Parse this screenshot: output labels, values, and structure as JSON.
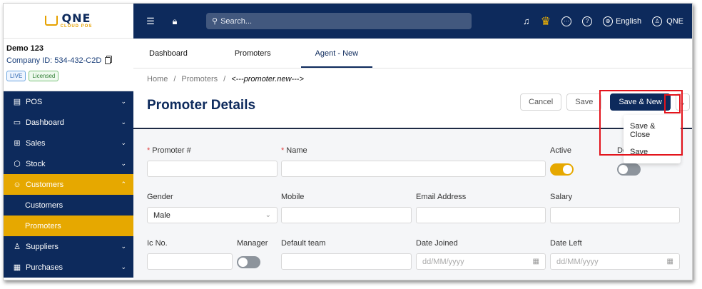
{
  "logo": {
    "main": "QNE",
    "sub": "CLOUD POS"
  },
  "company": {
    "name": "Demo 123",
    "id": "Company ID: 534-432-C2D",
    "badge_live": "LIVE",
    "badge_licensed": "Licensed"
  },
  "nav": {
    "pos": "POS",
    "dashboard": "Dashboard",
    "sales": "Sales",
    "stock": "Stock",
    "customers": "Customers",
    "sub_customers": "Customers",
    "sub_promoters": "Promoters",
    "suppliers": "Suppliers",
    "purchases": "Purchases"
  },
  "topbar": {
    "search_placeholder": "Search...",
    "language": "English",
    "user": "QNE"
  },
  "tabs": {
    "t1": "Dashboard",
    "t2": "Promoters",
    "t3": "Agent - New"
  },
  "breadcrumb": {
    "home": "Home",
    "sep": "/",
    "promoters": "Promoters",
    "current": "<---promoter.new--->"
  },
  "page_title": "Promoter Details",
  "actions": {
    "cancel": "Cancel",
    "save": "Save",
    "save_new": "Save & New"
  },
  "dropdown": {
    "save_close": "Save & Close",
    "save": "Save"
  },
  "form": {
    "promoter_no": {
      "label": "Promoter #",
      "value": ""
    },
    "name": {
      "label": "Name",
      "value": ""
    },
    "active": {
      "label": "Active",
      "on": true
    },
    "default_label": "De",
    "gender": {
      "label": "Gender",
      "value": "Male"
    },
    "mobile": {
      "label": "Mobile",
      "value": ""
    },
    "email": {
      "label": "Email Address",
      "value": ""
    },
    "salary": {
      "label": "Salary",
      "value": ""
    },
    "ic_no": {
      "label": "Ic No.",
      "value": ""
    },
    "manager": {
      "label": "Manager",
      "on": false
    },
    "default_team": {
      "label": "Default team",
      "value": ""
    },
    "date_joined": {
      "label": "Date Joined",
      "placeholder": "dd/MM/yyyy"
    },
    "date_left": {
      "label": "Date Left",
      "placeholder": "dd/MM/yyyy"
    }
  },
  "colors": {
    "navy": "#0d2a5c",
    "accent": "#e6a800",
    "highlight": "#e3141c"
  }
}
